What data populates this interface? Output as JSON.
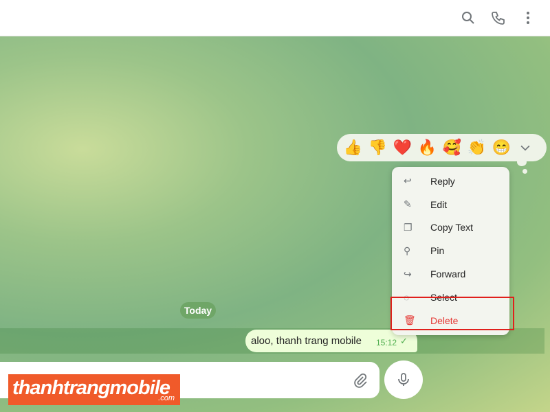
{
  "header": {
    "icons": [
      "search-icon",
      "phone-icon",
      "more-vertical-icon"
    ]
  },
  "chat": {
    "date_label": "Today",
    "message": {
      "text": "aloo, thanh trang mobile",
      "time": "15:12",
      "status": "sent-check"
    }
  },
  "reactions": [
    "👍",
    "👎",
    "❤️",
    "🔥",
    "🥰",
    "👏",
    "😁"
  ],
  "context_menu": [
    {
      "label": "Reply",
      "icon": "reply-icon"
    },
    {
      "label": "Edit",
      "icon": "pencil-icon"
    },
    {
      "label": "Copy Text",
      "icon": "copy-icon"
    },
    {
      "label": "Pin",
      "icon": "pin-icon"
    },
    {
      "label": "Forward",
      "icon": "forward-icon"
    },
    {
      "label": "Select",
      "icon": "check-circle-icon"
    },
    {
      "label": "Delete",
      "icon": "trash-icon"
    }
  ],
  "watermark": {
    "name": "thanhtrangmobile",
    "domain": ".com"
  },
  "colors": {
    "delete": "#e53935",
    "highlight_box": "#e0201c",
    "watermark": "#f05a2a"
  }
}
